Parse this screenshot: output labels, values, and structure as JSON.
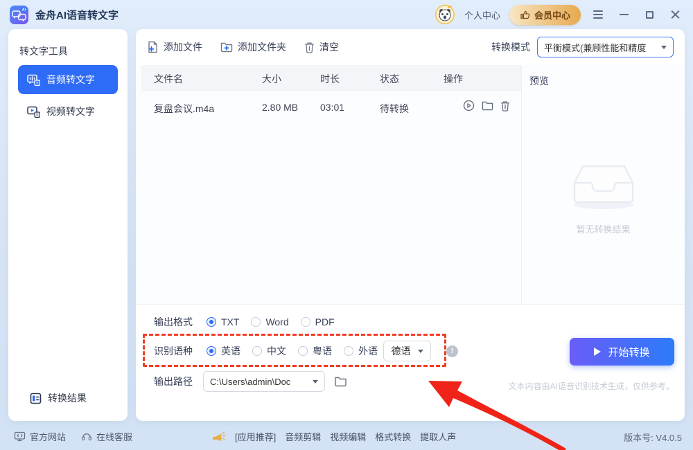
{
  "titlebar": {
    "app_title": "金舟AI语音转文字",
    "personal_center": "个人中心",
    "member_center": "会员中心"
  },
  "sidebar": {
    "section_title": "转文字工具",
    "items": [
      {
        "label": "音频转文字"
      },
      {
        "label": "视频转文字"
      }
    ],
    "active_item": "音频转文字",
    "results_label": "转换结果"
  },
  "toolbar": {
    "add_file": "添加文件",
    "add_folder": "添加文件夹",
    "clear": "清空",
    "mode_label": "转换模式",
    "mode_value": "平衡模式(兼顾性能和精度"
  },
  "table": {
    "headers": [
      "文件名",
      "大小",
      "时长",
      "状态",
      "操作"
    ],
    "rows": [
      {
        "name": "复盘会议.m4a",
        "size": "2.80 MB",
        "duration": "03:01",
        "status": "待转换"
      }
    ]
  },
  "preview": {
    "title": "预览",
    "empty_text": "暂无转换结果"
  },
  "controls": {
    "output_format_label": "输出格式",
    "format_options": [
      "TXT",
      "Word",
      "PDF"
    ],
    "format_selected": "TXT",
    "language_label": "识别语种",
    "language_options": [
      "英语",
      "中文",
      "粤语",
      "外语"
    ],
    "language_selected": "英语",
    "foreign_language_value": "德语",
    "output_path_label": "输出路径",
    "output_path_value": "C:\\Users\\admin\\Doc",
    "start_button": "开始转换",
    "disclaimer": "文本内容由AI语音识别技术生成，仅供参考。"
  },
  "footer": {
    "official_site": "官方网站",
    "online_service": "在线客服",
    "recommend_tag": "[应用推荐]",
    "links": [
      "音频剪辑",
      "视频编辑",
      "格式转换",
      "提取人声"
    ],
    "version": "版本号: V4.0.5"
  },
  "colors": {
    "accent_blue": "#2e6bf6",
    "member_gold": "#e6a94e",
    "annotation_red": "#f33a22",
    "start_gradient": [
      "#6a5df8",
      "#2d7bf9"
    ]
  }
}
